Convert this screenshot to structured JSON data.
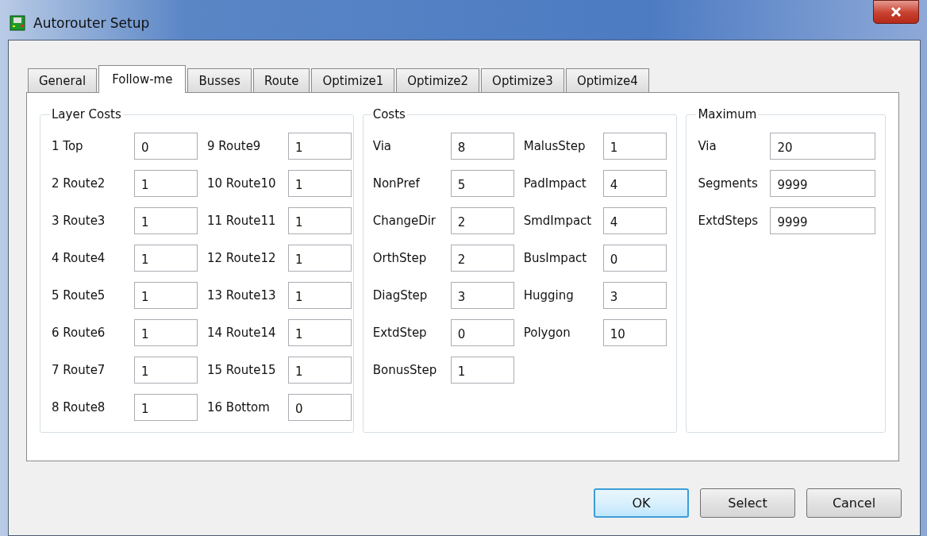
{
  "window": {
    "title": "Autorouter Setup"
  },
  "tabs": [
    {
      "label": "General",
      "selected": false
    },
    {
      "label": "Follow-me",
      "selected": true
    },
    {
      "label": "Busses",
      "selected": false
    },
    {
      "label": "Route",
      "selected": false
    },
    {
      "label": "Optimize1",
      "selected": false
    },
    {
      "label": "Optimize2",
      "selected": false
    },
    {
      "label": "Optimize3",
      "selected": false
    },
    {
      "label": "Optimize4",
      "selected": false
    }
  ],
  "groups": [
    {
      "title": "Layer Costs",
      "columns": [
        [
          {
            "label": "1 Top",
            "value": "0"
          },
          {
            "label": "2 Route2",
            "value": "1"
          },
          {
            "label": "3 Route3",
            "value": "1"
          },
          {
            "label": "4 Route4",
            "value": "1"
          },
          {
            "label": "5 Route5",
            "value": "1"
          },
          {
            "label": "6 Route6",
            "value": "1"
          },
          {
            "label": "7 Route7",
            "value": "1"
          },
          {
            "label": "8 Route8",
            "value": "1"
          }
        ],
        [
          {
            "label": "9 Route9",
            "value": "1"
          },
          {
            "label": "10 Route10",
            "value": "1"
          },
          {
            "label": "11 Route11",
            "value": "1"
          },
          {
            "label": "12 Route12",
            "value": "1"
          },
          {
            "label": "13 Route13",
            "value": "1"
          },
          {
            "label": "14 Route14",
            "value": "1"
          },
          {
            "label": "15 Route15",
            "value": "1"
          },
          {
            "label": "16 Bottom",
            "value": "0"
          }
        ]
      ]
    },
    {
      "title": "Costs",
      "columns": [
        [
          {
            "label": "Via",
            "value": "8"
          },
          {
            "label": "NonPref",
            "value": "5"
          },
          {
            "label": "ChangeDir",
            "value": "2"
          },
          {
            "label": "OrthStep",
            "value": "2"
          },
          {
            "label": "DiagStep",
            "value": "3"
          },
          {
            "label": "ExtdStep",
            "value": "0"
          },
          {
            "label": "BonusStep",
            "value": "1"
          }
        ],
        [
          {
            "label": "MalusStep",
            "value": "1"
          },
          {
            "label": "PadImpact",
            "value": "4"
          },
          {
            "label": "SmdImpact",
            "value": "4"
          },
          {
            "label": "BusImpact",
            "value": "0"
          },
          {
            "label": "Hugging",
            "value": "3"
          },
          {
            "label": "Polygon",
            "value": "10"
          }
        ]
      ]
    },
    {
      "title": "Maximum",
      "columns": [
        [
          {
            "label": "Via",
            "value": "20"
          },
          {
            "label": "Segments",
            "value": "9999"
          },
          {
            "label": "ExtdSteps",
            "value": "9999"
          }
        ]
      ]
    }
  ],
  "buttons": [
    {
      "label": "OK",
      "default": true
    },
    {
      "label": "Select",
      "default": false
    },
    {
      "label": "Cancel",
      "default": false
    }
  ]
}
